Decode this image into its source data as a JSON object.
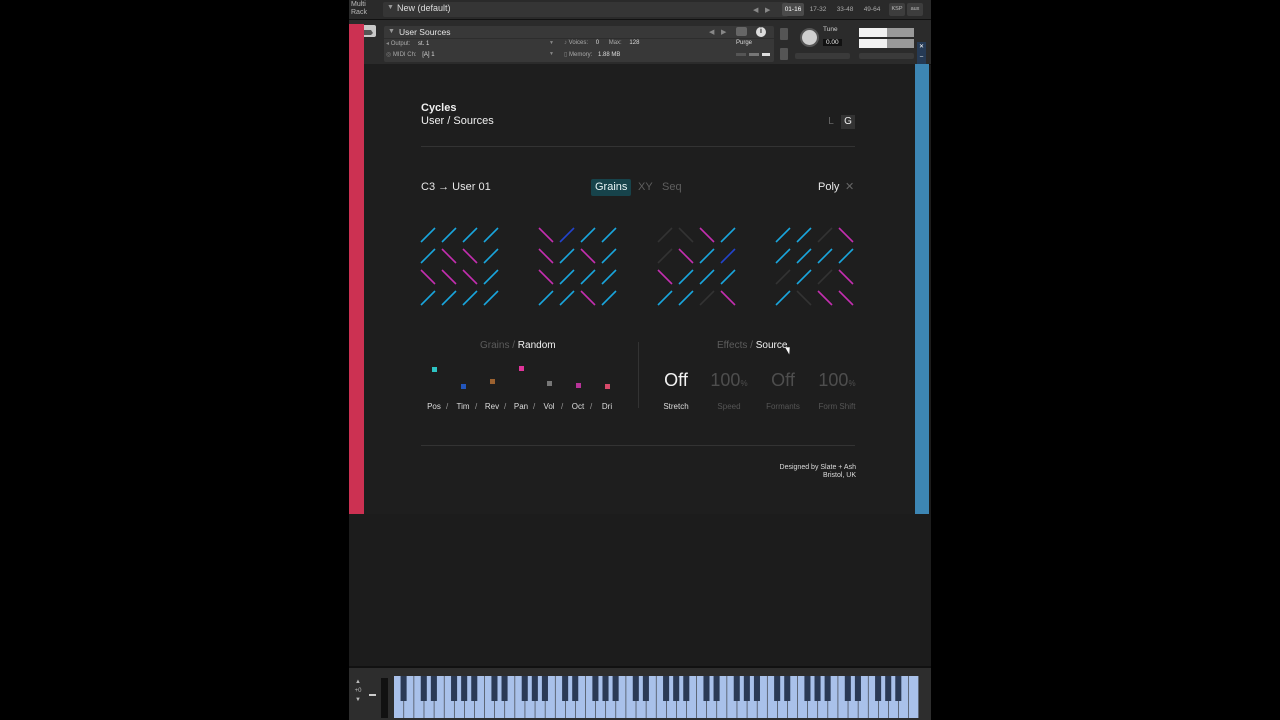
{
  "topbar": {
    "multirack_label_1": "Multi",
    "multirack_label_2": "Rack",
    "preset_name": "New (default)",
    "page_buttons": [
      "01-16",
      "17-32",
      "33-48",
      "49-64"
    ],
    "ksp_label": "KSP",
    "aux_label": "aux"
  },
  "instrument": {
    "name": "User Sources",
    "output_label": "Output:",
    "output_value": "st. 1",
    "voices_label": "Voices:",
    "voices_value": "0",
    "max_label": "Max:",
    "max_value": "128",
    "purge_label": "Purge",
    "midi_label": "MIDI Ch:",
    "midi_value": "[A]  1",
    "memory_label": "Memory:",
    "memory_value": "1.88 MB",
    "tune_label": "Tune",
    "tune_value": "0.00",
    "aux_small": "AUX",
    "pv_small": "PV"
  },
  "header": {
    "title": "Cycles",
    "subtitle": "User / Sources",
    "size_small": "L",
    "size_large": "G"
  },
  "mapping": {
    "label": "C3 → User 01",
    "tabs": [
      "Grains",
      "XY",
      "Seq"
    ],
    "active_tab": "Grains",
    "mode": "Poly",
    "close": "✕"
  },
  "colors": {
    "cyan": "#1aa6dd",
    "magenta": "#c42fb0",
    "blue": "#2244cc",
    "dim": "#333333",
    "accent_red": "#cc3152",
    "accent_blue": "#3d86b4"
  },
  "grain_patterns": [
    [
      "c",
      "c",
      "c",
      "c",
      "c",
      "m",
      "m",
      "c",
      "m",
      "m",
      "m",
      "c",
      "c",
      "c",
      "c",
      "c"
    ],
    [
      "m",
      "b",
      "c",
      "c",
      "m",
      "c",
      "m",
      "c",
      "m",
      "c",
      "c",
      "c",
      "c",
      "c",
      "m",
      "c"
    ],
    [
      "d",
      "d",
      "m",
      "c",
      "d",
      "m",
      "c",
      "b",
      "m",
      "c",
      "c",
      "c",
      "c",
      "c",
      "d",
      "m"
    ],
    [
      "c",
      "c",
      "d",
      "m",
      "c",
      "c",
      "c",
      "c",
      "d",
      "c",
      "d",
      "m",
      "c",
      "d",
      "m",
      "m"
    ]
  ],
  "grains_section": {
    "prefix": "Grains",
    "slash": "/",
    "mode": "Random",
    "params": [
      "Pos",
      "Tim",
      "Rev",
      "Pan",
      "Vol",
      "Oct",
      "Dri"
    ],
    "levels": [
      0.85,
      0.2,
      0.4,
      0.9,
      0.3,
      0.22,
      0.18
    ],
    "param_colors": [
      "#2ec4c4",
      "#2255bb",
      "#9c6230",
      "#e0349a",
      "#777777",
      "#b83399",
      "#d84a6a"
    ]
  },
  "source_section": {
    "prefix": "Effects",
    "slash": "/",
    "mode": "Source",
    "controls": [
      {
        "value": "Off",
        "unit": "",
        "label": "Stretch",
        "active": true
      },
      {
        "value": "100",
        "unit": "%",
        "label": "Speed",
        "active": false
      },
      {
        "value": "Off",
        "unit": "",
        "label": "Formants",
        "active": false
      },
      {
        "value": "100",
        "unit": "%",
        "label": "Form Shift",
        "active": false
      }
    ]
  },
  "credits": {
    "line1": "Designed by Slate + Ash",
    "line2": "Bristol, UK"
  },
  "keyboard": {
    "octave_up": "▲",
    "octave_value": "+0",
    "octave_down": "▼"
  }
}
